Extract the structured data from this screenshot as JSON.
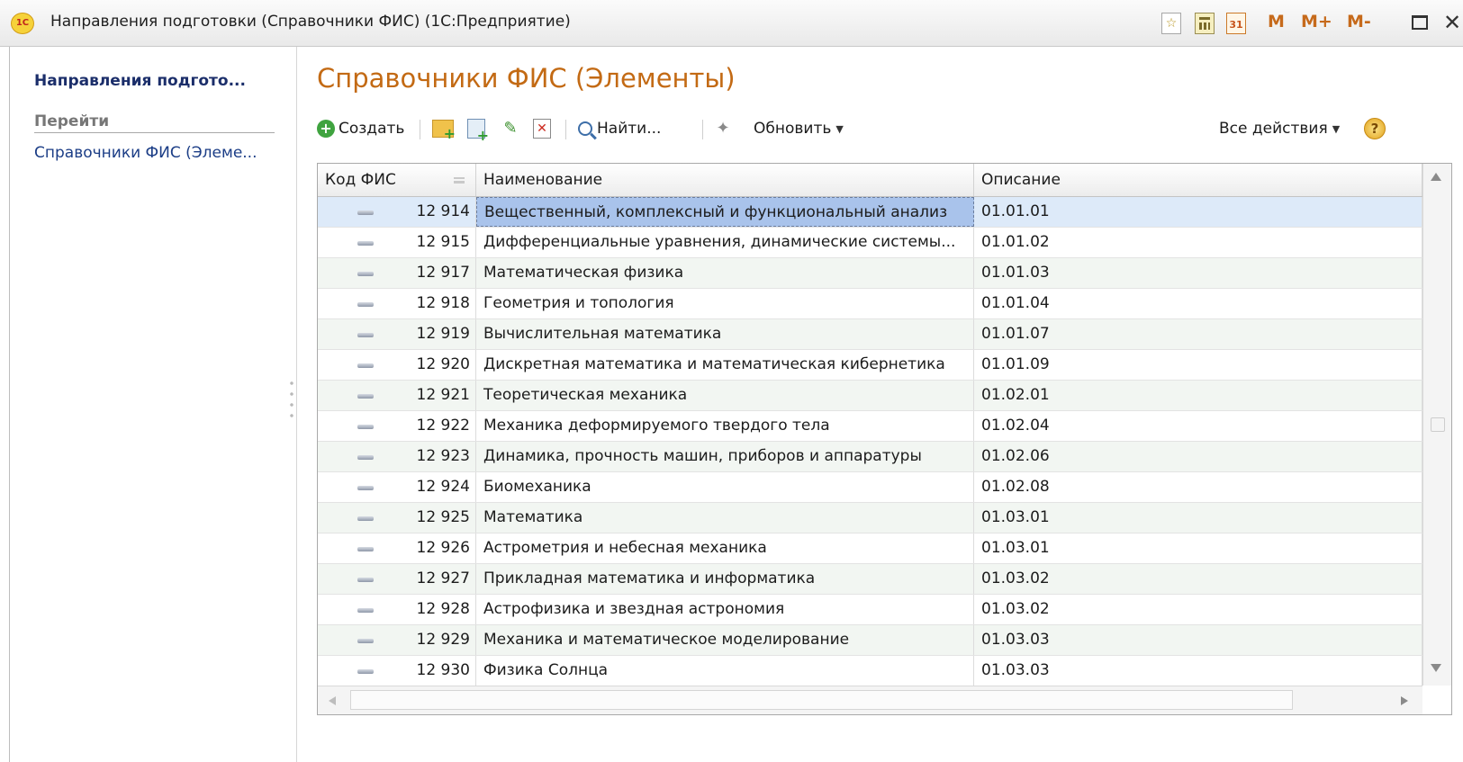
{
  "window": {
    "title": "Направления подготовки (Справочники ФИС)  (1С:Предприятие)",
    "logo": "1С",
    "mem": [
      "M",
      "M+",
      "M-"
    ],
    "close": "✕",
    "star": "☆",
    "cal": "31"
  },
  "nav": {
    "title": "Направления подгото...",
    "section": "Перейти",
    "link": "Справочники ФИС (Элеме..."
  },
  "form": {
    "title": "Справочники ФИС (Элементы)"
  },
  "toolbar": {
    "create_label": "Создать",
    "find_label": "Найти...",
    "refresh_label": "Обновить",
    "all_actions_label": "Все действия",
    "help": "?"
  },
  "table": {
    "columns": [
      "Код ФИС",
      "Наименование",
      "Описание"
    ],
    "rows": [
      {
        "code": "12 914",
        "name": "Вещественный, комплексный и функциональный анализ",
        "desc": "01.01.01"
      },
      {
        "code": "12 915",
        "name": "Дифференциальные уравнения, динамические системы...",
        "desc": "01.01.02"
      },
      {
        "code": "12 917",
        "name": "Математическая физика",
        "desc": "01.01.03"
      },
      {
        "code": "12 918",
        "name": "Геометрия и топология",
        "desc": "01.01.04"
      },
      {
        "code": "12 919",
        "name": "Вычислительная математика",
        "desc": "01.01.07"
      },
      {
        "code": "12 920",
        "name": "Дискретная математика и математическая кибернетика",
        "desc": "01.01.09"
      },
      {
        "code": "12 921",
        "name": "Теоретическая механика",
        "desc": "01.02.01"
      },
      {
        "code": "12 922",
        "name": "Механика деформируемого твердого тела",
        "desc": "01.02.04"
      },
      {
        "code": "12 923",
        "name": "Динамика, прочность машин, приборов и аппаратуры",
        "desc": "01.02.06"
      },
      {
        "code": "12 924",
        "name": "Биомеханика",
        "desc": "01.02.08"
      },
      {
        "code": "12 925",
        "name": "Математика",
        "desc": "01.03.01"
      },
      {
        "code": "12 926",
        "name": "Астрометрия и небесная механика",
        "desc": "01.03.01"
      },
      {
        "code": "12 927",
        "name": "Прикладная математика и информатика",
        "desc": "01.03.02"
      },
      {
        "code": "12 928",
        "name": "Астрофизика и звездная астрономия",
        "desc": "01.03.02"
      },
      {
        "code": "12 929",
        "name": "Механика и математическое моделирование",
        "desc": "01.03.03"
      },
      {
        "code": "12 930",
        "name": "Физика Солнца",
        "desc": "01.03.03"
      }
    ]
  }
}
